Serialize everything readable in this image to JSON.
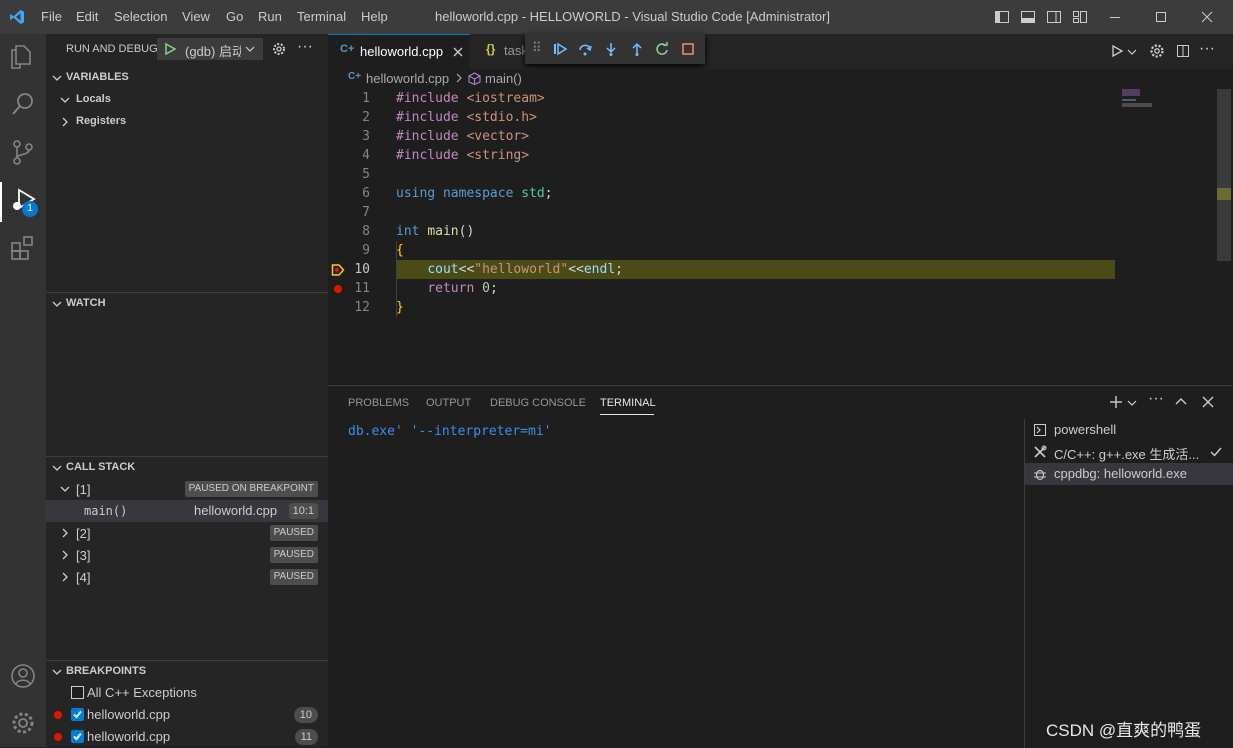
{
  "titlebar": {
    "menu": [
      "File",
      "Edit",
      "Selection",
      "View",
      "Go",
      "Run",
      "Terminal",
      "Help"
    ],
    "title": "helloworld.cpp - HELLOWORLD - Visual Studio Code [Administrator]"
  },
  "activity": {
    "debug_badge": "1"
  },
  "sidebar": {
    "header": "RUN AND DEBUG",
    "config": "(gdb) 启动",
    "variables": {
      "title": "VARIABLES",
      "items": [
        "Locals",
        "Registers"
      ]
    },
    "watch": {
      "title": "WATCH"
    },
    "callstack": {
      "title": "CALL STACK",
      "threads": [
        {
          "name": "[1]",
          "status": "PAUSED ON BREAKPOINT"
        },
        {
          "name": "[2]",
          "status": "PAUSED"
        },
        {
          "name": "[3]",
          "status": "PAUSED"
        },
        {
          "name": "[4]",
          "status": "PAUSED"
        }
      ],
      "frame": {
        "fn": "main()",
        "file": "helloworld.cpp",
        "pos": "10:1"
      }
    },
    "breakpoints": {
      "title": "BREAKPOINTS",
      "items": [
        {
          "label": "All C++ Exceptions",
          "checked": false,
          "count": ""
        },
        {
          "label": "helloworld.cpp",
          "checked": true,
          "count": "10"
        },
        {
          "label": "helloworld.cpp",
          "checked": true,
          "count": "11"
        }
      ]
    }
  },
  "editor": {
    "tabs": [
      {
        "label": "helloworld.cpp",
        "active": true
      },
      {
        "label": "tasks.json",
        "active": false
      }
    ],
    "breadcrumb": [
      "helloworld.cpp",
      "main()"
    ],
    "current_line": 10,
    "lines": [
      {
        "n": "1",
        "tokens": [
          [
            "pp",
            "#include "
          ],
          [
            "str",
            "<iostream>"
          ]
        ]
      },
      {
        "n": "2",
        "tokens": [
          [
            "pp",
            "#include "
          ],
          [
            "str",
            "<stdio.h>"
          ]
        ]
      },
      {
        "n": "3",
        "tokens": [
          [
            "pp",
            "#include "
          ],
          [
            "str",
            "<vector>"
          ]
        ]
      },
      {
        "n": "4",
        "tokens": [
          [
            "pp",
            "#include "
          ],
          [
            "str",
            "<string>"
          ]
        ]
      },
      {
        "n": "5",
        "tokens": []
      },
      {
        "n": "6",
        "tokens": [
          [
            "kw",
            "using "
          ],
          [
            "kw",
            "namespace "
          ],
          [
            "ty",
            "std"
          ],
          [
            "",
            "; "
          ]
        ]
      },
      {
        "n": "7",
        "tokens": []
      },
      {
        "n": "8",
        "tokens": [
          [
            "kw",
            "int "
          ],
          [
            "fn",
            "main"
          ],
          [
            "",
            "()"
          ]
        ]
      },
      {
        "n": "9",
        "tokens": [
          [
            "br",
            "{"
          ]
        ]
      },
      {
        "n": "10",
        "tokens": [
          [
            "",
            "    "
          ],
          [
            "vr",
            "cout"
          ],
          [
            "",
            "<<"
          ],
          [
            "str",
            "\"helloworld\""
          ],
          [
            "",
            "<<"
          ],
          [
            "vr",
            "endl"
          ],
          [
            "",
            ";"
          ]
        ]
      },
      {
        "n": "11",
        "tokens": [
          [
            "",
            "    "
          ],
          [
            "pp",
            "return "
          ],
          [
            "num",
            "0"
          ],
          [
            "",
            ";"
          ]
        ]
      },
      {
        "n": "12",
        "tokens": [
          [
            "br",
            "}"
          ]
        ]
      }
    ]
  },
  "panel": {
    "tabs": [
      "PROBLEMS",
      "OUTPUT",
      "DEBUG CONSOLE",
      "TERMINAL"
    ],
    "active_tab": "TERMINAL",
    "terminal_text": "db.exe' '--interpreter=mi'",
    "terminals": [
      "powershell",
      "C/C++: g++.exe 生成活...",
      "cppdbg: helloworld.exe"
    ]
  },
  "watermark": "CSDN @直爽的鸭蛋",
  "colors": {
    "accent": "#007acc",
    "breakpoint": "#e51400",
    "current_line": "#4b4b18"
  }
}
